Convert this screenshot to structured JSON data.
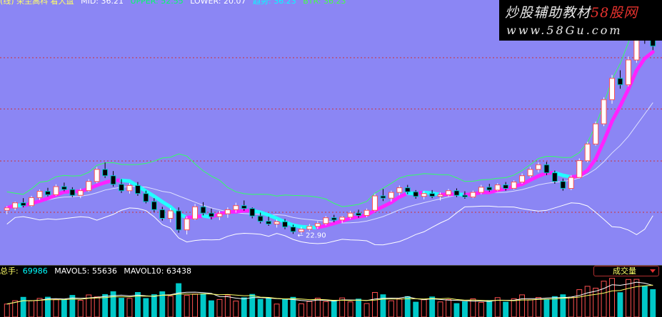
{
  "header": {
    "title": "(线) 荣至高科 看大盘",
    "mid": "MID: 36.21",
    "upper": "UPPER: 52.55",
    "lower": "LOWER: 20.07",
    "trend": "趋势: 36.23",
    "btr": "BTR: 36.23"
  },
  "watermark": {
    "line1_prefix": "炒股辅助教材",
    "line1_brand": "58股网",
    "line2": "www.58Gu.com"
  },
  "volume_header": {
    "label": "总手:",
    "value": "69986",
    "ma5": "MAVOL5: 55636",
    "ma10": "MAVOL10: 63438"
  },
  "volume_tab": {
    "label": "成交量"
  },
  "annotations": {
    "low_label": "22.90"
  },
  "colors": {
    "background_top": "#8b86f4",
    "background_bottom": "#000000",
    "up_candle": "#ff5050",
    "down_candle": "#00c8c8",
    "band_upper": "#33ff66",
    "band_mid": "#ffffff",
    "trend_up": "#ff22ff",
    "trend_down": "#22ffff",
    "grid": "#cc3333"
  },
  "chart_data": {
    "type": "candlestick",
    "title": "",
    "grid": true,
    "price_range": [
      14,
      60
    ],
    "candles": [
      [
        23.5,
        24.2,
        22.8,
        23.9
      ],
      [
        23.9,
        25.0,
        23.5,
        24.8
      ],
      [
        24.8,
        25.6,
        24.0,
        24.3
      ],
      [
        24.3,
        26.0,
        24.1,
        25.7
      ],
      [
        25.7,
        27.1,
        25.3,
        26.8
      ],
      [
        26.8,
        27.4,
        25.9,
        26.2
      ],
      [
        26.2,
        28.0,
        26.0,
        27.6
      ],
      [
        27.6,
        28.3,
        26.8,
        27.1
      ],
      [
        27.1,
        27.5,
        25.8,
        26.1
      ],
      [
        26.1,
        27.3,
        25.6,
        26.9
      ],
      [
        26.9,
        28.9,
        26.7,
        28.5
      ],
      [
        28.5,
        31.0,
        28.2,
        30.6
      ],
      [
        30.6,
        31.8,
        29.1,
        29.5
      ],
      [
        29.5,
        30.3,
        27.6,
        28.0
      ],
      [
        28.0,
        28.9,
        26.5,
        26.9
      ],
      [
        26.9,
        28.2,
        26.4,
        27.8
      ],
      [
        27.8,
        28.4,
        26.0,
        26.4
      ],
      [
        26.4,
        26.9,
        24.7,
        25.0
      ],
      [
        25.0,
        25.6,
        23.2,
        23.6
      ],
      [
        23.6,
        24.1,
        21.7,
        22.1
      ],
      [
        22.1,
        23.9,
        21.4,
        23.4
      ],
      [
        23.4,
        24.0,
        19.6,
        20.1
      ],
      [
        20.1,
        22.4,
        19.3,
        22.0
      ],
      [
        22.0,
        24.6,
        21.8,
        24.1
      ],
      [
        24.1,
        24.9,
        22.6,
        23.0
      ],
      [
        23.0,
        23.8,
        21.9,
        22.4
      ],
      [
        22.4,
        23.4,
        21.8,
        22.9
      ],
      [
        22.9,
        24.0,
        22.2,
        23.6
      ],
      [
        23.6,
        24.8,
        23.1,
        24.3
      ],
      [
        24.3,
        25.2,
        23.4,
        23.8
      ],
      [
        23.8,
        24.0,
        22.1,
        22.5
      ],
      [
        22.5,
        23.1,
        21.2,
        21.6
      ],
      [
        21.6,
        22.4,
        20.8,
        21.1
      ],
      [
        21.1,
        21.9,
        20.5,
        21.5
      ],
      [
        21.5,
        22.0,
        20.2,
        20.6
      ],
      [
        20.6,
        21.0,
        19.4,
        19.8
      ],
      [
        19.8,
        20.6,
        19.3,
        20.2
      ],
      [
        20.2,
        21.1,
        19.9,
        20.7
      ],
      [
        20.7,
        21.6,
        20.3,
        21.2
      ],
      [
        21.2,
        22.5,
        20.9,
        22.2
      ],
      [
        22.2,
        22.7,
        21.4,
        21.8
      ],
      [
        21.8,
        22.5,
        21.3,
        22.3
      ],
      [
        22.3,
        23.4,
        22.0,
        23.0
      ],
      [
        23.0,
        23.6,
        22.2,
        22.6
      ],
      [
        22.6,
        23.8,
        22.3,
        23.5
      ],
      [
        23.5,
        26.4,
        23.3,
        26.0
      ],
      [
        26.0,
        27.2,
        25.1,
        25.6
      ],
      [
        25.6,
        26.9,
        25.0,
        26.6
      ],
      [
        26.6,
        27.8,
        26.1,
        27.4
      ],
      [
        27.4,
        27.9,
        26.3,
        26.7
      ],
      [
        26.7,
        27.0,
        25.5,
        25.9
      ],
      [
        25.9,
        26.8,
        25.4,
        26.4
      ],
      [
        26.4,
        27.0,
        25.6,
        25.9
      ],
      [
        25.9,
        26.6,
        25.2,
        26.2
      ],
      [
        26.2,
        27.2,
        25.9,
        26.9
      ],
      [
        26.9,
        27.3,
        25.8,
        26.1
      ],
      [
        26.1,
        26.8,
        25.5,
        25.8
      ],
      [
        25.8,
        26.9,
        25.6,
        26.6
      ],
      [
        26.6,
        27.9,
        26.3,
        27.5
      ],
      [
        27.5,
        28.1,
        26.7,
        27.0
      ],
      [
        27.0,
        28.2,
        26.8,
        27.9
      ],
      [
        27.9,
        28.4,
        26.9,
        27.3
      ],
      [
        27.3,
        28.7,
        27.1,
        28.4
      ],
      [
        28.4,
        29.9,
        28.1,
        29.5
      ],
      [
        29.5,
        31.0,
        29.2,
        30.6
      ],
      [
        30.6,
        31.8,
        30.1,
        31.4
      ],
      [
        31.4,
        31.9,
        29.6,
        30.0
      ],
      [
        30.0,
        30.4,
        28.1,
        28.5
      ],
      [
        28.5,
        29.0,
        26.9,
        27.3
      ],
      [
        27.3,
        29.6,
        27.0,
        29.2
      ],
      [
        29.2,
        32.5,
        29.0,
        32.1
      ],
      [
        32.1,
        35.4,
        31.8,
        35.0
      ],
      [
        35.0,
        38.9,
        34.7,
        38.5
      ],
      [
        38.5,
        43.1,
        38.1,
        42.7
      ],
      [
        42.7,
        47.0,
        42.0,
        46.4
      ],
      [
        46.4,
        47.8,
        44.6,
        45.3
      ],
      [
        45.3,
        50.2,
        45.0,
        49.6
      ],
      [
        49.6,
        55.3,
        49.1,
        54.8
      ],
      [
        54.8,
        56.7,
        52.4,
        53.2
      ],
      [
        53.2,
        54.4,
        51.3,
        52.0
      ]
    ]
  }
}
